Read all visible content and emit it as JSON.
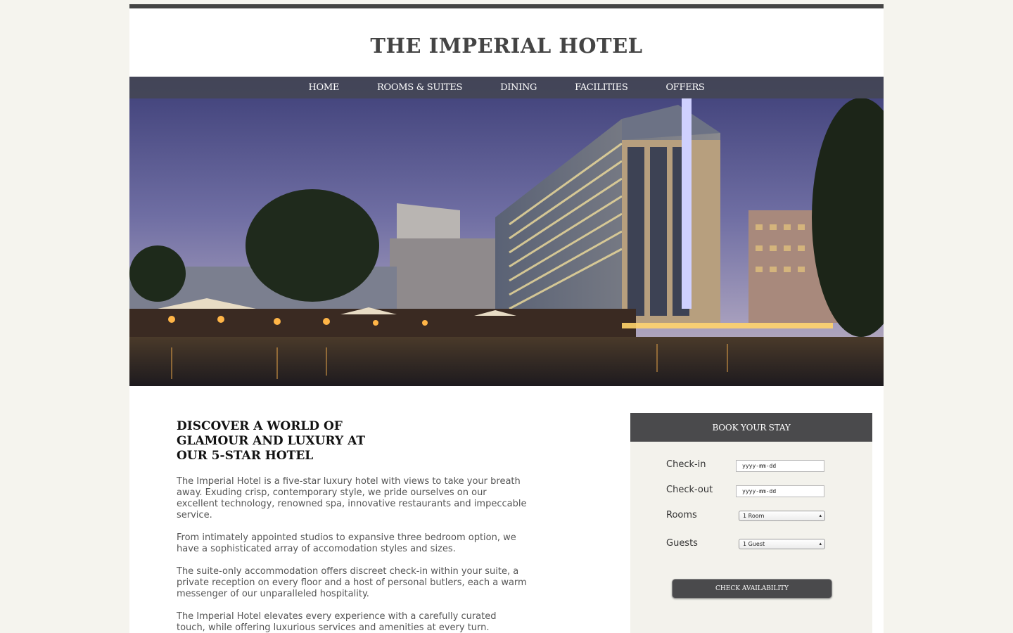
{
  "site": {
    "title": "THE IMPERIAL HOTEL"
  },
  "nav": {
    "items": [
      {
        "label": "HOME"
      },
      {
        "label": "ROOMS & SUITES"
      },
      {
        "label": "DINING"
      },
      {
        "label": "FACILITIES"
      },
      {
        "label": "OFFERS"
      }
    ]
  },
  "hero": {
    "image_description": "hotel-at-dusk-photo"
  },
  "content": {
    "heading": "DISCOVER A WORLD OF GLAMOUR AND LUXURY AT OUR 5-STAR HOTEL",
    "paragraphs": [
      "The Imperial Hotel is a five-star luxury hotel with views to take your breath away. Exuding crisp, contemporary style, we pride ourselves on our excellent technology, renowned spa, innovative restaurants and impeccable service.",
      "From intimately appointed studios to expansive three bedroom option, we have a sophisticated array of accomodation styles and sizes.",
      "The suite-only accommodation offers discreet check-in within your suite, a private reception on every floor and a host of personal butlers, each a warm messenger of our unparalleled hospitality.",
      "The Imperial Hotel elevates every experience with a carefully curated touch, while offering luxurious services and amenities at every turn."
    ]
  },
  "booking": {
    "header": "BOOK YOUR STAY",
    "checkin_label": "Check-in",
    "checkin_placeholder": "yyyy-mm-dd",
    "checkout_label": "Check-out",
    "checkout_placeholder": "yyyy-mm-dd",
    "rooms_label": "Rooms",
    "rooms_value": "1 Room",
    "guests_label": "Guests",
    "guests_value": "1 Guest",
    "button_label": "CHECK AVAILABILITY"
  },
  "colors": {
    "background": "#f5f4ee",
    "accent_dark": "#444444",
    "nav_bg": "#444655",
    "panel_bg": "#f3f2ec"
  }
}
